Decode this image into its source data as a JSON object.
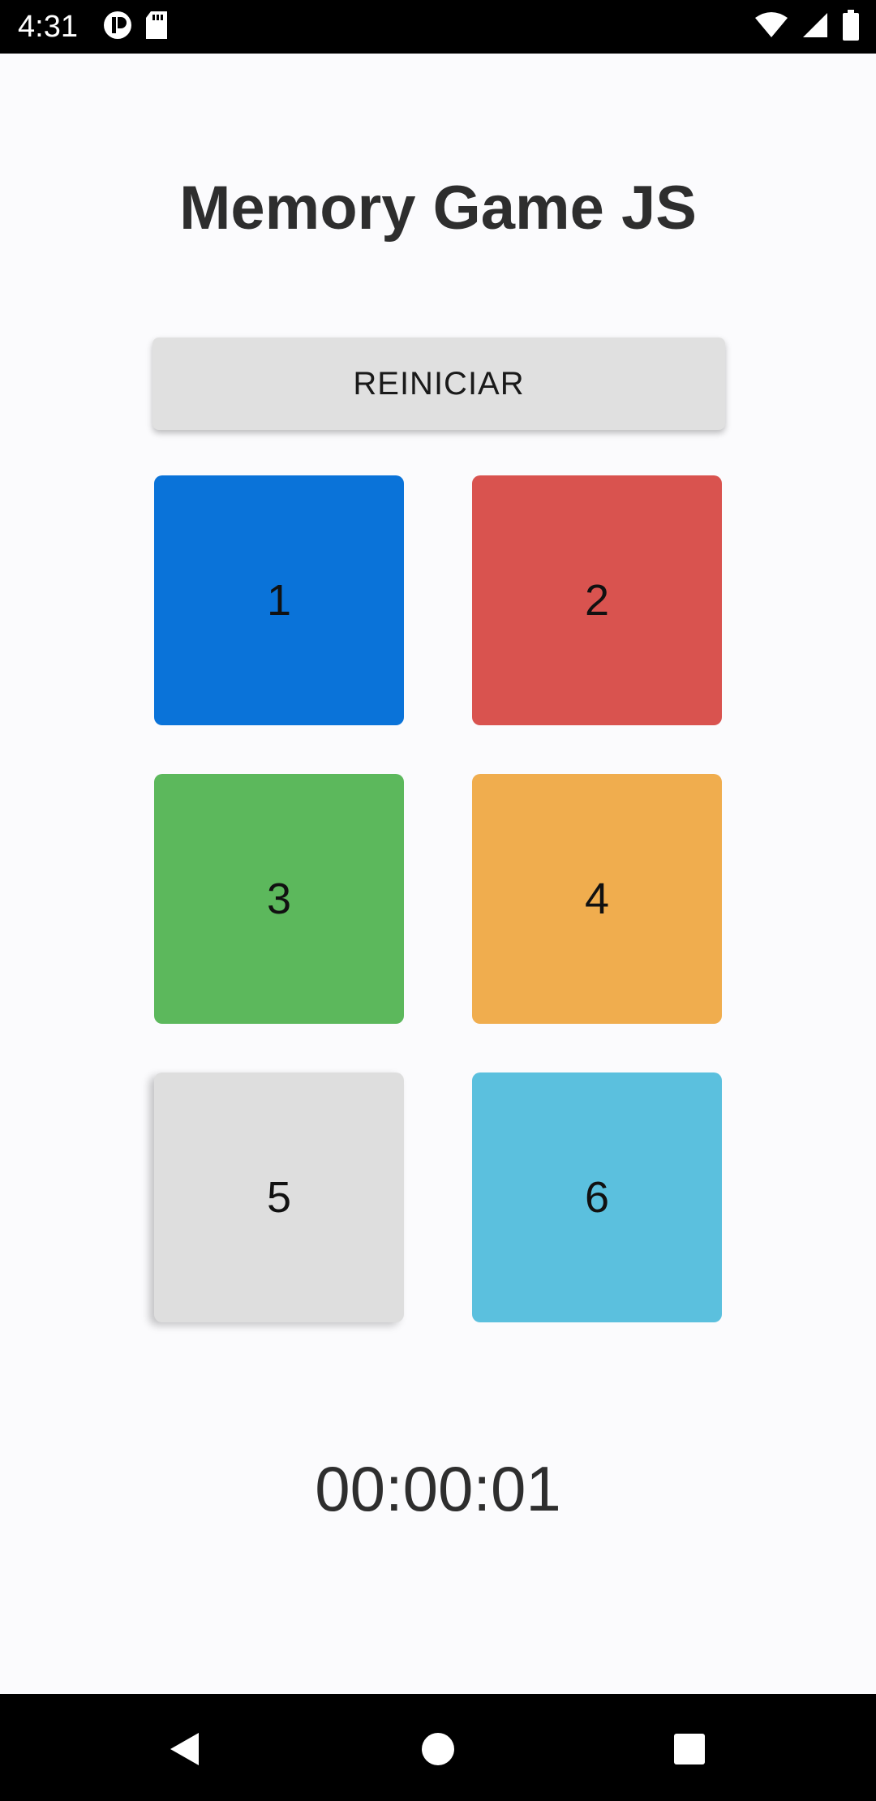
{
  "status_bar": {
    "time": "4:31",
    "left_icons": [
      "alert-icon",
      "sd-card-icon"
    ],
    "right_icons": [
      "wifi-icon",
      "signal-icon",
      "battery-icon"
    ]
  },
  "app": {
    "title": "Memory Game JS",
    "restart_label": "REINICIAR",
    "tiles": [
      {
        "label": "1",
        "color": "#0a73d9"
      },
      {
        "label": "2",
        "color": "#d9534f"
      },
      {
        "label": "3",
        "color": "#5cb85c"
      },
      {
        "label": "4",
        "color": "#f0ad4e"
      },
      {
        "label": "5",
        "color": "#dedede"
      },
      {
        "label": "6",
        "color": "#5bc0de"
      }
    ],
    "timer": "00:00:01"
  },
  "nav_bar": {
    "buttons": [
      "back-icon",
      "home-icon",
      "recent-apps-icon"
    ]
  }
}
